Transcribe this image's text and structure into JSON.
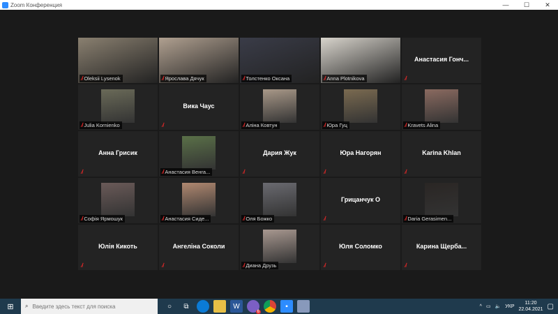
{
  "window": {
    "title": "Zoom Конференция",
    "min": "—",
    "max": "☐",
    "close": "✕"
  },
  "participants": [
    {
      "name": "Oleksii Lysenok",
      "type": "video",
      "bg": "#8a8070"
    },
    {
      "name": "Ярослава Дячук",
      "type": "video",
      "bg": "#b0a090"
    },
    {
      "name": "Толстенко Оксана",
      "type": "video",
      "bg": "#3a3c48"
    },
    {
      "name": "Anna Plotnikova",
      "type": "video",
      "bg": "#d8d4cc",
      "active": true
    },
    {
      "name": "Анастасия  Гонч...",
      "type": "name"
    },
    {
      "name": "Julia Kornienko",
      "type": "avatar",
      "bg": "#6a6a58"
    },
    {
      "name": "Вика Чаус",
      "type": "name"
    },
    {
      "name": "Аліна Ковтун",
      "type": "avatar",
      "bg": "#a89888"
    },
    {
      "name": "Юра Гуц",
      "type": "avatar",
      "bg": "#7a6a50"
    },
    {
      "name": "Kravets Alina",
      "type": "avatar",
      "bg": "#8a6a60"
    },
    {
      "name": "Анна Грисик",
      "type": "name"
    },
    {
      "name": "Анастасия Венга...",
      "type": "avatar",
      "bg": "#5a7048"
    },
    {
      "name": "Дария Жук",
      "type": "name"
    },
    {
      "name": "Юра Нагорян",
      "type": "name"
    },
    {
      "name": "Karina Khlan",
      "type": "name"
    },
    {
      "name": "Софія Ярмошук",
      "type": "avatar",
      "bg": "#6a5a58"
    },
    {
      "name": "Анастасия Сиде...",
      "type": "avatar",
      "bg": "#b08870"
    },
    {
      "name": "Оля Божко",
      "type": "avatar",
      "bg": "#6a6a70"
    },
    {
      "name": "Грицанчук  О",
      "type": "name"
    },
    {
      "name": "Daria Gerasimen...",
      "type": "avatar",
      "bg": "#2a2624"
    },
    {
      "name": "Юлія Кикоть",
      "type": "name"
    },
    {
      "name": "Ангеліна Соколи",
      "type": "name"
    },
    {
      "name": "Диана Друзь",
      "type": "avatar",
      "bg": "#a89890"
    },
    {
      "name": "Юля Соломко",
      "type": "name"
    },
    {
      "name": "Карина  Щерба...",
      "type": "name"
    }
  ],
  "taskbar": {
    "search_placeholder": "Введите здесь текст для поиска",
    "lang": "УКР",
    "time": "11:20",
    "date": "22.04.2021",
    "badge": "6"
  }
}
